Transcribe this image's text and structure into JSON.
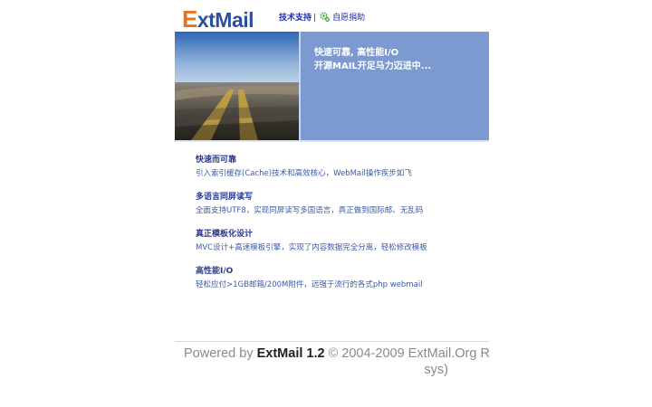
{
  "header": {
    "logo_e": "E",
    "logo_rest": "xtMail",
    "support_link": "技术支持",
    "separator": "|",
    "donate_link": "自愿捐助",
    "gear_icon": "gear-icon"
  },
  "banner": {
    "line1": "快速可靠, 高性能I/O",
    "line2": "开源MAIL开足马力迈进中..."
  },
  "features": [
    {
      "title": "快速而可靠",
      "desc": "引入索引缓存(Cache)技术和高效核心，WebMail操作疾步如飞"
    },
    {
      "title": "多语言同屏读写",
      "desc": "全面支持UTF8，实现同屏读写多国语言，真正做到国际邮、无乱码"
    },
    {
      "title": "真正模板化设计",
      "desc": "MVC设计+高速模板引擎，实现了内容数据完全分离，轻松修改模板"
    },
    {
      "title": "高性能I/O",
      "desc": "轻松应付>1GB邮箱/200M附件，远强于流行的各式php webmail"
    }
  ],
  "footer": {
    "powered_by": "Powered by ",
    "brand": "ExtMail 1.2",
    "copyright": " © 2004-2009 ExtMail.Org R",
    "line2": "sys)"
  },
  "colors": {
    "banner_bg": "#7d9ad0",
    "logo_orange": "#e8731c",
    "logo_blue": "#2d4f9c",
    "link_blue": "#1f2fb0"
  }
}
